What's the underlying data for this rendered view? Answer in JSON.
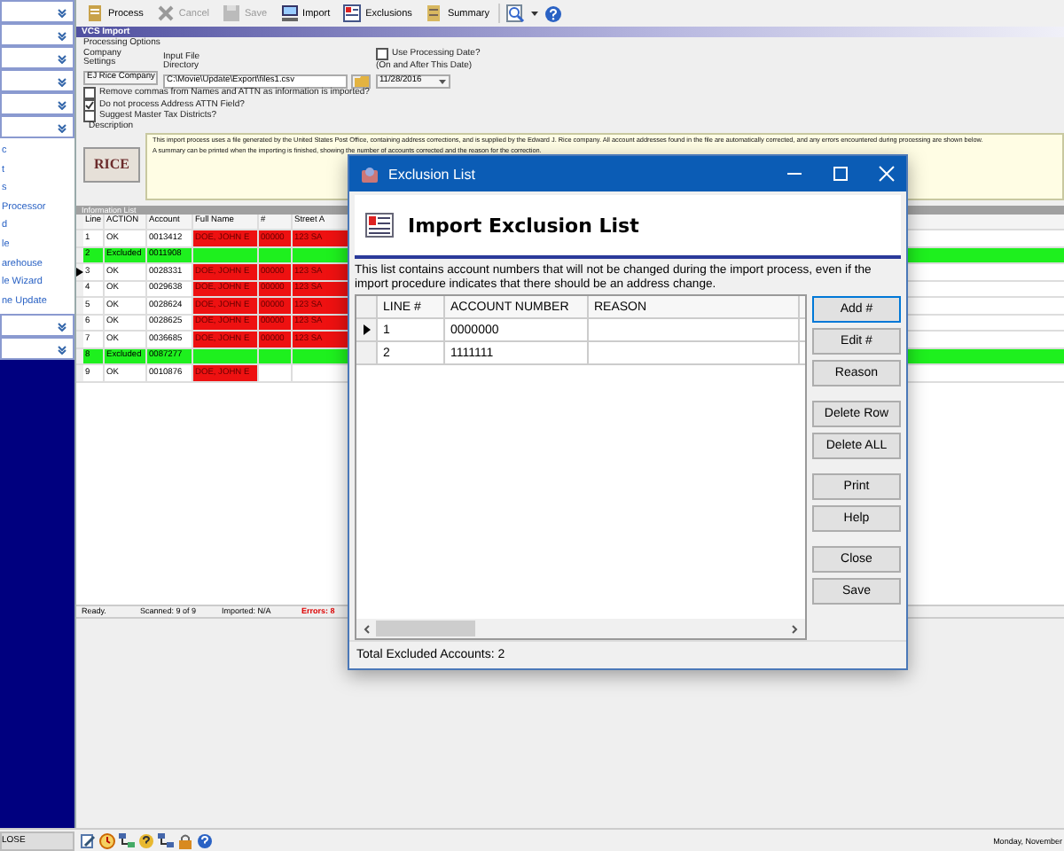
{
  "sidebar": {
    "top_sections": [
      {
        "expanded": false
      },
      {
        "expanded": false
      },
      {
        "expanded": false
      },
      {
        "expanded": false
      },
      {
        "expanded": false
      },
      {
        "expanded": false
      }
    ],
    "links": [
      "c",
      "t",
      "s",
      "Processor",
      "d",
      "le",
      "arehouse",
      "le Wizard",
      "ne Update"
    ],
    "bottom_sections": [
      {
        "expanded": false
      },
      {
        "expanded": false
      }
    ],
    "footer": "LOSE"
  },
  "toolbar": [
    {
      "label": "Process",
      "disabled": false
    },
    {
      "label": "Cancel",
      "disabled": true
    },
    {
      "label": "Save",
      "disabled": true
    },
    {
      "label": "Import",
      "disabled": false
    },
    {
      "label": "Exclusions",
      "disabled": false
    },
    {
      "label": "Summary",
      "disabled": false
    }
  ],
  "panel_title": "VCS Import",
  "options": {
    "heading": "Processing Options",
    "company_label": "Company Settings",
    "company_value": "EJ Rice Company",
    "file_label": "Input File Directory",
    "file_value": "C:\\Movie\\Update\\Export\\files1.csv",
    "date_check": {
      "label": "Use Processing Date?",
      "checked": false
    },
    "date_label": "(On and After This Date)",
    "date_value": "11/28/2016",
    "checks": [
      {
        "label": "Remove commas from Names and ATTN as information is imported?",
        "checked": false
      },
      {
        "label": "Do not process Address ATTN Field?",
        "checked": true
      },
      {
        "label": "Suggest Master Tax Districts?",
        "checked": false
      }
    ]
  },
  "description": {
    "label": "Description",
    "logo": "RICE",
    "paragraphs": [
      "This import process uses a file generated by the United States Post Office, containing address corrections, and is supplied by the Edward J. Rice company.  All account addresses found in the file are automatically corrected, and any errors encountered during processing are shown below.",
      "A summary can be printed when the importing is finished, showing the number of accounts corrected and the reason for the correction."
    ]
  },
  "info_list": {
    "title": "Information List",
    "columns": [
      "Line",
      "ACTION",
      "Account",
      "Full Name",
      "#",
      "Street A"
    ],
    "rows": [
      {
        "kind": "ok",
        "selected": false,
        "cells": [
          "1",
          "OK",
          "0013412",
          "DOE, JOHN E",
          "00000",
          "123 SA"
        ]
      },
      {
        "kind": "excluded",
        "selected": false,
        "cells": [
          "2",
          "Excluded",
          "0011908"
        ]
      },
      {
        "kind": "ok",
        "selected": true,
        "cells": [
          "3",
          "OK",
          "0028331",
          "DOE, JOHN E",
          "00000",
          "123 SA"
        ]
      },
      {
        "kind": "ok",
        "selected": false,
        "cells": [
          "4",
          "OK",
          "0029638",
          "DOE, JOHN E",
          "00000",
          "123 SA"
        ]
      },
      {
        "kind": "ok",
        "selected": false,
        "cells": [
          "5",
          "OK",
          "0028624",
          "DOE, JOHN E",
          "00000",
          "123 SA"
        ]
      },
      {
        "kind": "ok",
        "selected": false,
        "cells": [
          "6",
          "OK",
          "0028625",
          "DOE, JOHN E",
          "00000",
          "123 SA"
        ]
      },
      {
        "kind": "ok",
        "selected": false,
        "cells": [
          "7",
          "OK",
          "0036685",
          "DOE, JOHN E",
          "00000",
          "123 SA"
        ]
      },
      {
        "kind": "excluded",
        "selected": false,
        "cells": [
          "8",
          "Excluded",
          "0087277"
        ]
      },
      {
        "kind": "ok",
        "selected": false,
        "cells": [
          "9",
          "OK",
          "0010876",
          "DOE, JOHN E"
        ]
      }
    ]
  },
  "status_bar": [
    "Ready.",
    "Scanned: 9 of 9",
    "Imported: N/A",
    "Errors: 8"
  ],
  "taskbar": {
    "date": "Monday, November"
  },
  "dialog": {
    "title": "Exclusion List",
    "heading": "Import Exclusion List",
    "intro": "This list contains account numbers that will not be changed during the import process, even if the import procedure indicates that there should be an address change.",
    "columns": [
      "LINE #",
      "ACCOUNT NUMBER",
      "REASON"
    ],
    "rows": [
      {
        "selected": true,
        "cells": [
          "1",
          "0000000",
          ""
        ]
      },
      {
        "selected": false,
        "cells": [
          "2",
          "1111111",
          ""
        ]
      }
    ],
    "buttons": [
      {
        "label": "Add #",
        "focused": true
      },
      {
        "label": "Edit #",
        "focused": false
      },
      {
        "label": "Reason",
        "focused": false
      },
      {
        "label": "Delete Row",
        "focused": false
      },
      {
        "label": "Delete ALL",
        "focused": false
      },
      {
        "label": "Print",
        "focused": false
      },
      {
        "label": "Help",
        "focused": false
      },
      {
        "label": "Close",
        "focused": false
      },
      {
        "label": "Save",
        "focused": false
      }
    ],
    "status": "Total Excluded Accounts: 2"
  }
}
